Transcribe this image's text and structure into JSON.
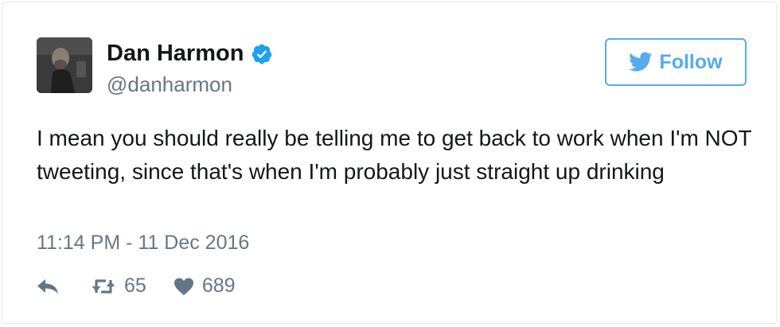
{
  "user": {
    "display_name": "Dan Harmon",
    "handle": "@danharmon",
    "verified": true
  },
  "follow_button": {
    "label": "Follow"
  },
  "tweet": {
    "text": "I mean you should really be telling me to get back to work when I'm NOT tweeting, since that's when I'm probably just straight up drinking",
    "timestamp": "11:14 PM - 11 Dec 2016"
  },
  "actions": {
    "retweet_count": "65",
    "like_count": "689"
  },
  "colors": {
    "accent": "#55acee",
    "text": "#14171a",
    "muted": "#657786",
    "verified": "#1da1f2"
  },
  "icons": [
    "avatar-photo",
    "verified-icon",
    "twitter-bird-icon",
    "reply-icon",
    "retweet-icon",
    "heart-icon"
  ]
}
